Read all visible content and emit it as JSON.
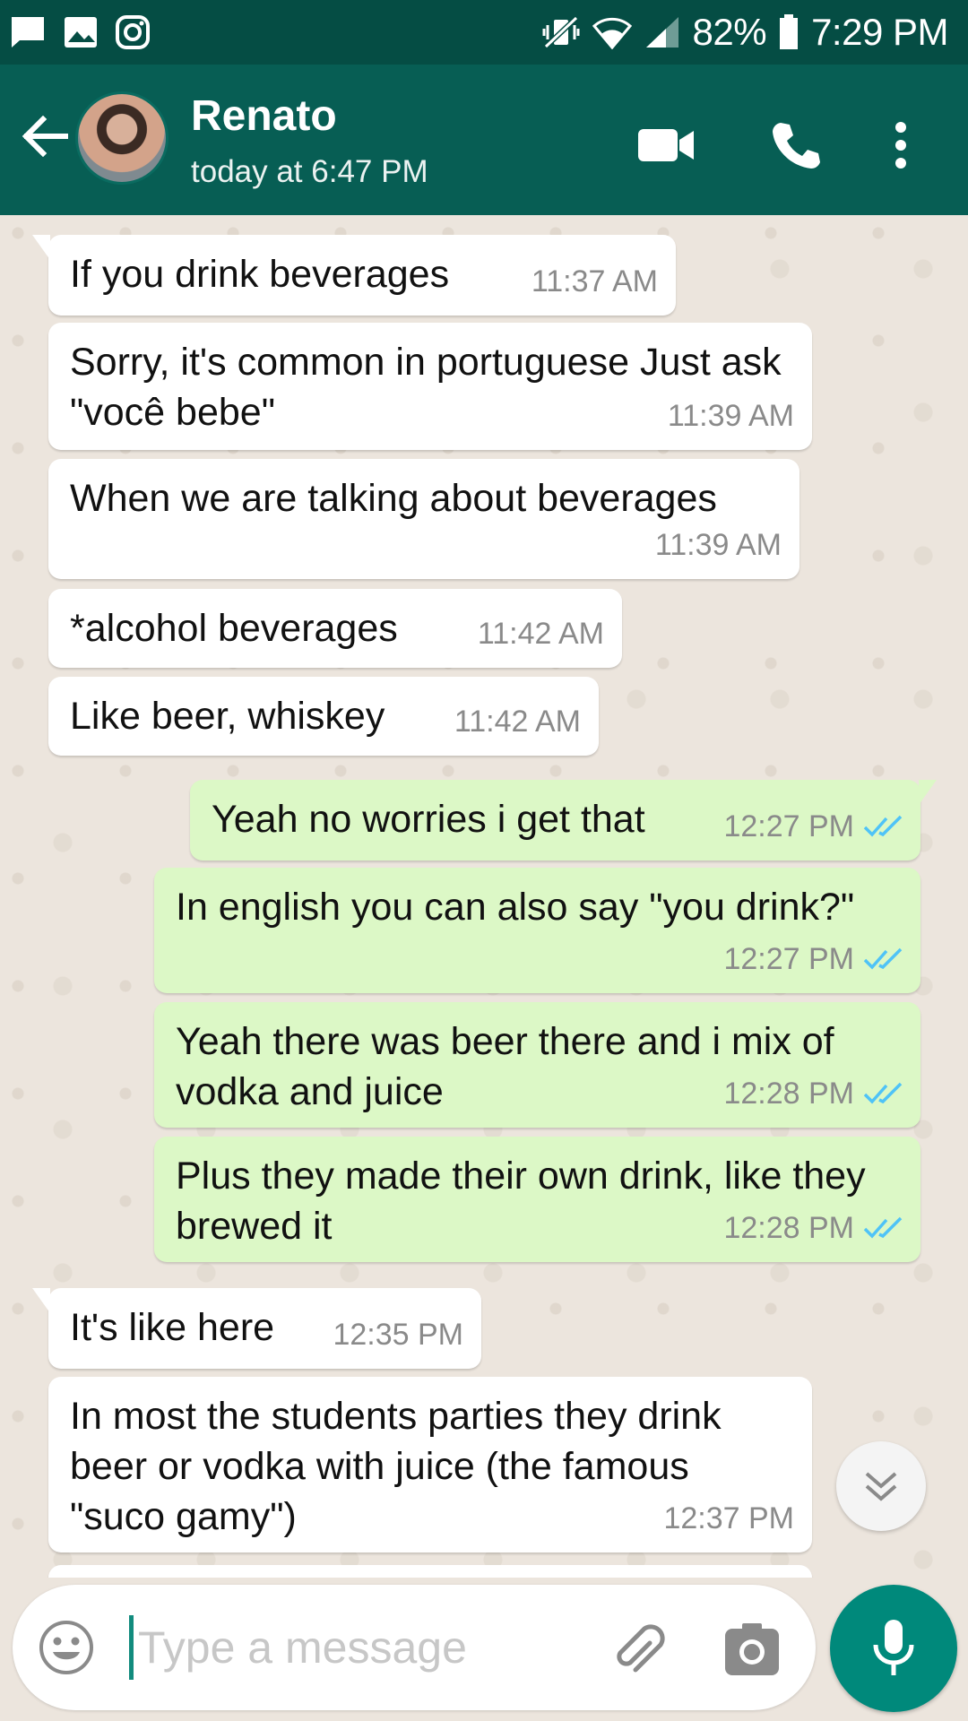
{
  "status_bar": {
    "battery": "82%",
    "time": "7:29 PM",
    "left_icons": [
      "message-icon",
      "image-icon",
      "instagram-icon"
    ],
    "right_icons": [
      "vibrate-off-icon",
      "wifi-icon",
      "signal-icon",
      "battery-icon"
    ]
  },
  "header": {
    "contact_name": "Renato",
    "last_seen": "today at 6:47 PM",
    "icons": [
      "back-arrow-icon",
      "video-call-icon",
      "phone-icon",
      "more-vert-icon"
    ]
  },
  "messages": [
    {
      "direction": "in",
      "text": "If you drink beverages",
      "time": "11:37 AM"
    },
    {
      "direction": "in",
      "text": "Sorry, it's common in portuguese Just ask \"você bebe\"",
      "time": "11:39 AM"
    },
    {
      "direction": "in",
      "text": "When we are talking about beverages",
      "time": "11:39 AM"
    },
    {
      "direction": "in",
      "text": "*alcohol beverages",
      "time": "11:42 AM"
    },
    {
      "direction": "in",
      "text": "Like beer, whiskey",
      "time": "11:42 AM"
    },
    {
      "direction": "out",
      "text": "Yeah no worries i get that",
      "time": "12:27 PM",
      "status": "read"
    },
    {
      "direction": "out",
      "text": "In english you can also say \"you drink?\"",
      "time": "12:27 PM",
      "status": "read"
    },
    {
      "direction": "out",
      "text": "Yeah there was beer there and i mix of vodka and juice",
      "time": "12:28 PM",
      "status": "read"
    },
    {
      "direction": "out",
      "text": "Plus they made their own drink, like they brewed it",
      "time": "12:28 PM",
      "status": "read"
    },
    {
      "direction": "in",
      "text": "It's like here",
      "time": "12:35 PM"
    },
    {
      "direction": "in",
      "text": "In most the students parties they drink beer or vodka with juice (the famous \"suco gamy\")",
      "time": "12:37 PM"
    }
  ],
  "input": {
    "placeholder": "Type a message",
    "value": ""
  },
  "colors": {
    "status_bar": "#054d44",
    "header": "#075e54",
    "chat_background": "#ece5dd",
    "incoming_bubble": "#ffffff",
    "outgoing_bubble": "#dcf8c6",
    "read_ticks": "#4fc3f7",
    "mic_button": "#00897b"
  }
}
